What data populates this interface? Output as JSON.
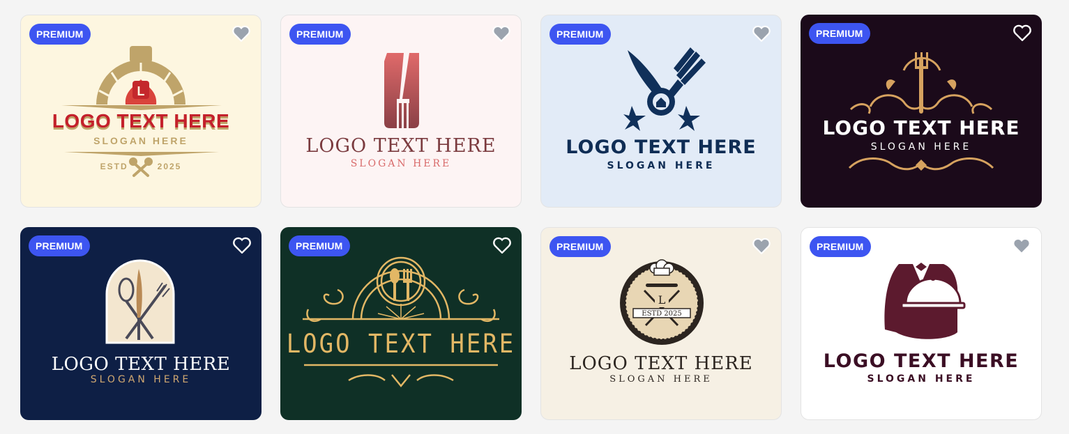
{
  "colors": {
    "badge_bg": "#3d55f1",
    "page_bg": "#f4f4f4"
  },
  "cards": [
    {
      "badge": "PREMIUM",
      "logo_text": "LOGO TEXT HERE",
      "slogan": "SLOGAN HERE",
      "estd": "ESTD",
      "year": "2025",
      "letter": "L",
      "bg": "#fdf6e0",
      "favorite_icon": "heart-icon"
    },
    {
      "badge": "PREMIUM",
      "logo_text": "LOGO TEXT HERE",
      "slogan": "SLOGAN HERE",
      "bg": "#fdf4f4",
      "favorite_icon": "heart-icon"
    },
    {
      "badge": "PREMIUM",
      "logo_text": "LOGO TEXT HERE",
      "slogan": "SLOGAN HERE",
      "bg": "#e2ebf7",
      "favorite_icon": "heart-icon"
    },
    {
      "badge": "PREMIUM",
      "logo_text": "LOGO TEXT HERE",
      "slogan": "SLOGAN HERE",
      "bg": "#1b0a1a",
      "favorite_icon": "heart-icon"
    },
    {
      "badge": "PREMIUM",
      "logo_text": "LOGO TEXT HERE",
      "slogan": "SLOGAN HERE",
      "bg": "#0e1f45",
      "favorite_icon": "heart-icon"
    },
    {
      "badge": "PREMIUM",
      "logo_text": "LOGO TEXT HERE",
      "bg": "#0f3026",
      "favorite_icon": "heart-icon"
    },
    {
      "badge": "PREMIUM",
      "logo_text": "LOGO TEXT HERE",
      "slogan": "SLOGAN HERE",
      "emblem_text": "ESTD 2025",
      "emblem_letter": "L",
      "bg": "#f6f0e4",
      "favorite_icon": "heart-icon"
    },
    {
      "badge": "PREMIUM",
      "logo_text": "LOGO TEXT HERE",
      "slogan": "SLOGAN HERE",
      "bg": "#ffffff",
      "favorite_icon": "heart-icon"
    }
  ]
}
